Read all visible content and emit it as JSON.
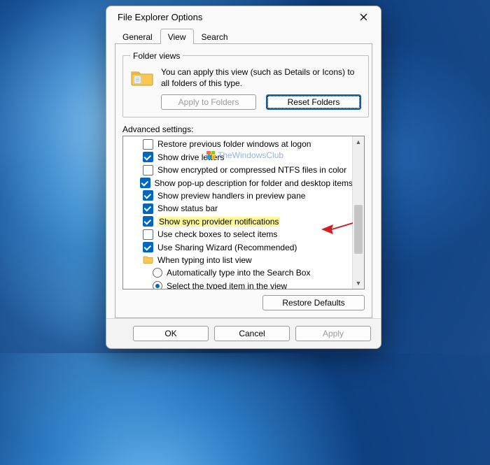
{
  "dialog_title": "File Explorer Options",
  "tabs": {
    "general": "General",
    "view": "View",
    "search": "Search"
  },
  "folder_views": {
    "legend": "Folder views",
    "text": "You can apply this view (such as Details or Icons) to all folders of this type.",
    "apply_btn": "Apply to Folders",
    "reset_btn": "Reset Folders"
  },
  "watermark": "TheWindowsClub",
  "advanced_label": "Advanced settings:",
  "options": [
    {
      "type": "check",
      "checked": false,
      "label": "Restore previous folder windows at logon"
    },
    {
      "type": "check",
      "checked": true,
      "label": "Show drive letters"
    },
    {
      "type": "check",
      "checked": false,
      "label": "Show encrypted or compressed NTFS files in color"
    },
    {
      "type": "check",
      "checked": true,
      "label": "Show pop-up description for folder and desktop items"
    },
    {
      "type": "check",
      "checked": true,
      "label": "Show preview handlers in preview pane"
    },
    {
      "type": "check",
      "checked": true,
      "label": "Show status bar"
    },
    {
      "type": "check",
      "checked": true,
      "label": "Show sync provider notifications",
      "highlight": true
    },
    {
      "type": "check",
      "checked": false,
      "label": "Use check boxes to select items"
    },
    {
      "type": "check",
      "checked": true,
      "label": "Use Sharing Wizard (Recommended)"
    },
    {
      "type": "folder",
      "label": "When typing into list view"
    },
    {
      "type": "radio",
      "checked": false,
      "label": "Automatically type into the Search Box"
    },
    {
      "type": "radio",
      "checked": true,
      "label": "Select the typed item in the view"
    }
  ],
  "restore_defaults": "Restore Defaults",
  "footer": {
    "ok": "OK",
    "cancel": "Cancel",
    "apply": "Apply"
  }
}
